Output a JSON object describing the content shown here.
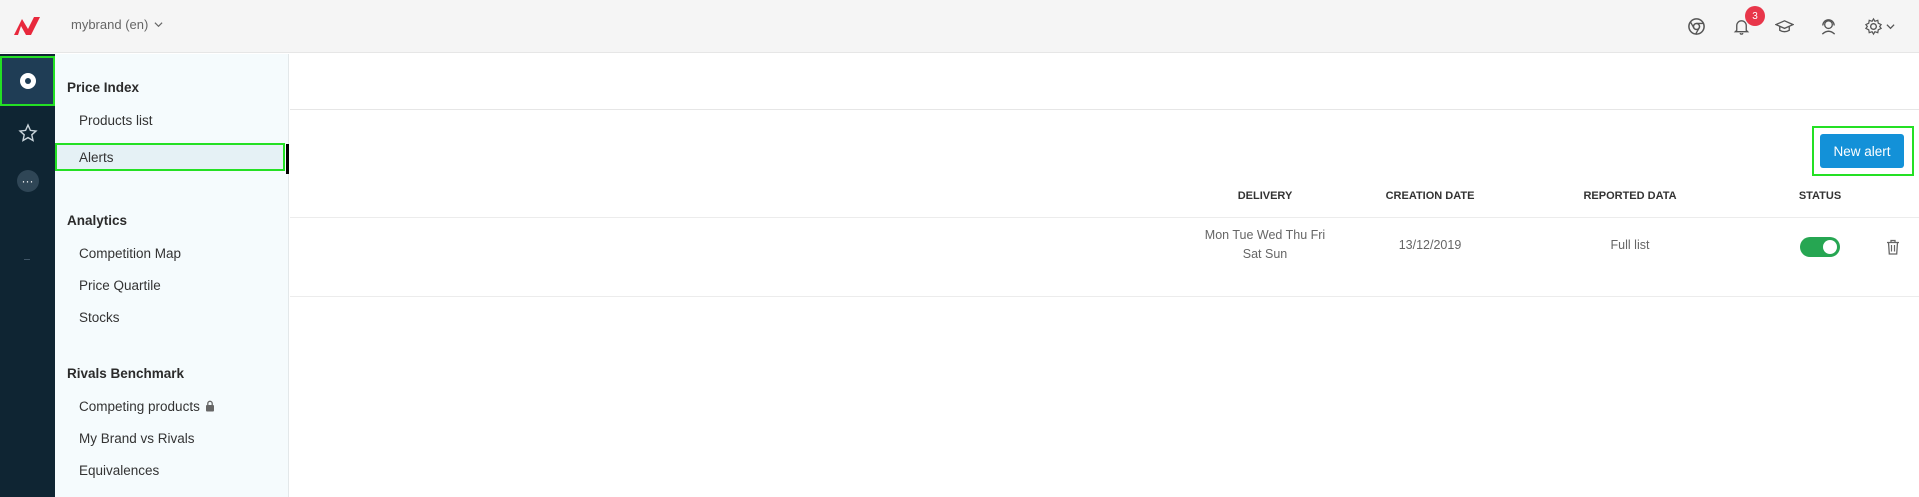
{
  "topbar": {
    "brand_selector": "mybrand (en)",
    "notification_count": "3",
    "icons": [
      "chrome-icon",
      "bell-icon",
      "graduation-cap-icon",
      "support-agent-icon",
      "gear-icon"
    ]
  },
  "sidebar": {
    "sections": [
      {
        "title": "Price Index",
        "items": [
          "Products list",
          "Alerts"
        ]
      },
      {
        "title": "Analytics",
        "items": [
          "Competition Map",
          "Price Quartile",
          "Stocks"
        ]
      },
      {
        "title": "Rivals Benchmark",
        "items": [
          "Competing products",
          "My Brand vs Rivals",
          "Equivalences"
        ]
      }
    ],
    "active_item": "Alerts"
  },
  "main": {
    "new_alert_label": "New alert",
    "columns": [
      "DELIVERY",
      "CREATION DATE",
      "REPORTED DATA",
      "STATUS"
    ],
    "rows": [
      {
        "delivery_line1": "Mon Tue Wed Thu Fri",
        "delivery_line2": "Sat Sun",
        "creation_date": "13/12/2019",
        "reported_data": "Full list",
        "status_enabled": true
      }
    ]
  },
  "colors": {
    "accent": "#1391d8",
    "rail": "#0f2533",
    "toggle_on": "#26a652",
    "badge": "#e8364a",
    "logo": "#e8283c",
    "highlight": "#24e024"
  }
}
